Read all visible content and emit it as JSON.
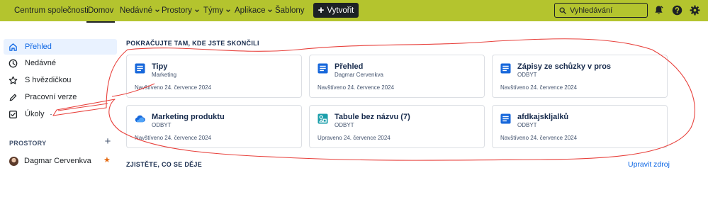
{
  "topbar": {
    "nav": [
      {
        "label": "Centrum společnosti"
      },
      {
        "label": "Domov"
      },
      {
        "label": "Nedávné"
      },
      {
        "label": "Prostory"
      },
      {
        "label": "Týmy"
      },
      {
        "label": "Aplikace"
      },
      {
        "label": "Šablony"
      }
    ],
    "create_label": "Vytvořit",
    "search_placeholder": "Vyhledávání",
    "icons": [
      "search-icon",
      "notifications-icon",
      "help-icon",
      "settings-icon"
    ],
    "bar_color": "#b4c42e"
  },
  "sidebar": {
    "items": [
      {
        "label": "Přehled",
        "icon": "home-icon"
      },
      {
        "label": "Nedávné",
        "icon": "clock-icon"
      },
      {
        "label": "S hvězdičkou",
        "icon": "star-icon"
      },
      {
        "label": "Pracovní verze",
        "icon": "pencil-icon"
      },
      {
        "label": "Úkoly",
        "icon": "checkbox-icon",
        "badge": "-"
      }
    ],
    "spaces_heading": "PROSTORY",
    "spaces": [
      {
        "name": "Dagmar Cervenkva"
      }
    ]
  },
  "main": {
    "continue_title": "POKRAČUJTE TAM, KDE JSTE SKONČILI",
    "cards": [
      {
        "title": "Tipy",
        "subtitle": "Marketing",
        "meta": "Navštíveno 24. července 2024",
        "icon": "page-icon"
      },
      {
        "title": "Přehled",
        "subtitle": "Dagmar Cervenkva",
        "meta": "Navštíveno 24. července 2024",
        "icon": "page-icon"
      },
      {
        "title": "Zápisy ze schůzky v pros",
        "subtitle": "ODBYT",
        "meta": "Navštíveno 24. července 2024",
        "icon": "page-icon"
      },
      {
        "title": "Marketing produktu",
        "subtitle": "ODBYT",
        "meta": "Navštíveno 24. července 2024",
        "icon": "cloud-icon"
      },
      {
        "title": "Tabule bez názvu (7)",
        "subtitle": "ODBYT",
        "meta": "Upraveno 24. července 2024",
        "icon": "whiteboard-icon"
      },
      {
        "title": "afdkajskljalků",
        "subtitle": "ODBYT",
        "meta": "Navštíveno 24. července 2024",
        "icon": "page-icon"
      }
    ],
    "happening_title": "ZJISTĚTE, CO SE DĚJE",
    "edit_feed_label": "Upravit zdroj"
  },
  "colors": {
    "accent_blue": "#0c66e4",
    "annotation_red": "#e8413c",
    "star_orange": "#e56910"
  }
}
